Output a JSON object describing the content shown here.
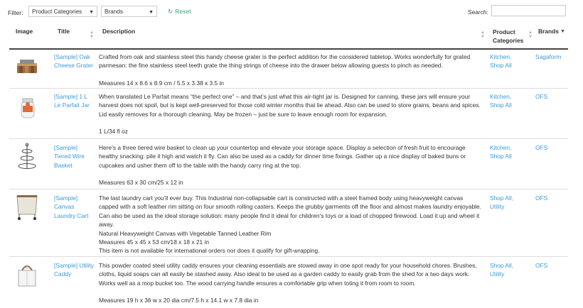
{
  "filters": {
    "label": "Filter:",
    "category_select": "Product Categories",
    "brand_select": "Brands",
    "reset_label": "Reset",
    "search_label": "Search:",
    "search_value": ""
  },
  "table": {
    "headers": {
      "image": "Image",
      "title": "Title",
      "description": "Description",
      "categories": "Product Categories",
      "brands": "Brands"
    },
    "rows": [
      {
        "title": "[Sample] Oak Cheese Grater",
        "image_icon": "cheese-grater-icon",
        "description": [
          "Crafted from oak and stainless steel this handy cheese grater is the perfect addition for the considered tabletop. Works wonderfully for grated parmesan: the fine stainless steel teeth grate the thing strings of cheese into the drawer below allowing guests to pinch as needed.",
          "",
          "Measures 14 x 8.6 x 8.9 cm / 5.5 x 3.38 x 3.5 in"
        ],
        "categories": [
          "Kitchen,",
          "Shop All"
        ],
        "brand": "Sagaform"
      },
      {
        "title": "[Sample] 1 L Le Parfait Jar",
        "image_icon": "glass-jar-icon",
        "description": [
          "When translated Le Parfait means “the perfect one” – and that’s just what this air-tight jar is. Designed for canning, these jars will ensure your harvest does not spoil, but is kept well-preserved for those cold winter months that lie ahead. Also can be used to store grains, beans and spices. Lid easily removes for a thorough cleaning. May be frozen – just be sure to leave enough room for expansion.",
          "",
          "1 L/34 fl oz"
        ],
        "categories": [
          "Kitchen,",
          "Shop All"
        ],
        "brand": "OFS"
      },
      {
        "title": "[Sample] Tiered Wire Basket",
        "image_icon": "tiered-basket-icon",
        "description": [
          "Here’s a three tiered wire basket to clean up your countertop and elevate your storage space. Display a selection of fresh fruit to encourage healthy snacking: pile it high and watch it fly. Can also be used as a caddy for dinner time fixings. Gather up a nice display of baked buns or cupcakes and usher them off to the table with the handy carry ring at the top.",
          "",
          "Measures 63 x 30 cm/25 x 12 in"
        ],
        "categories": [
          "Kitchen,",
          "Shop All"
        ],
        "brand": "OFS"
      },
      {
        "title": "[Sample] Canvas Laundry Cart",
        "image_icon": "laundry-cart-icon",
        "description": [
          "The last laundry cart you’ll ever buy. This Industrial non-collapsable cart is constructed with a steel framed body using heavyweight canvas capped with a soft leather rim sitting on four smooth rolling casters. Keeps the grubby garments off the floor and almost makes laundry enjoyable. Can also be used as the ideal storage solution: many people find it ideal for children’s toys or a load of chopped firewood. Load it up and wheel it away.",
          "Natural Heavyweight Canvas with Vegetable Tanned Leather Rim",
          "Measures 45 x 45 x 53 cm/18 x 18 x 21 in",
          "This item is not available for international orders nor does it qualify for gift-wrapping."
        ],
        "categories": [
          "Shop All,",
          "Utility"
        ],
        "brand": "OFS"
      },
      {
        "title": "[Sample] Utility Caddy",
        "image_icon": "utility-caddy-icon",
        "description": [
          "This powder coated steel utility caddy ensures your cleaning essentials are stowed away in one spot ready for your household chores. Brushes, cloths, liquid soaps can all easily be stashed away. Also ideal to be used as a garden caddy to easily grab from the shed for a two days work. Works well as a mop bucket too. The wood carrying handle ensures a comfortable grip when toting it from room to room.",
          "",
          "Measures 19 h x 36 w x 20 dia cm/7.5 h x 14.1 w x 7.8 dia in"
        ],
        "categories": [
          "Shop All,",
          "Utility"
        ],
        "brand": "OFS"
      }
    ]
  }
}
